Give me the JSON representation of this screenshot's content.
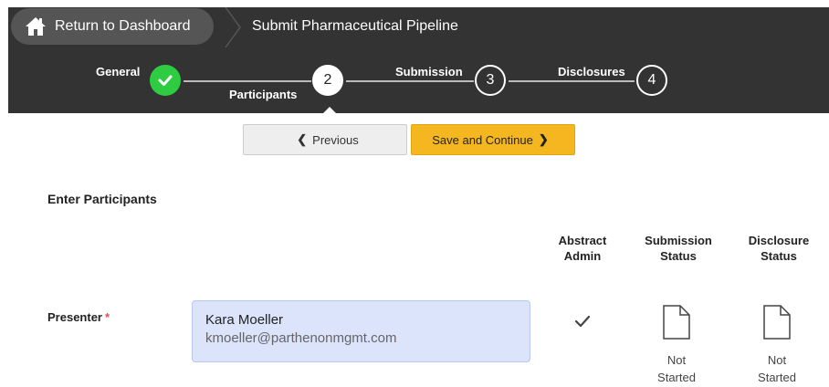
{
  "breadcrumb": {
    "return_label": "Return to Dashboard",
    "title": "Submit Pharmaceutical Pipeline"
  },
  "steps": [
    {
      "label": "General",
      "number": "",
      "state": "complete"
    },
    {
      "label": "Participants",
      "number": "2",
      "state": "active"
    },
    {
      "label": "Submission",
      "number": "3",
      "state": "pending"
    },
    {
      "label": "Disclosures",
      "number": "4",
      "state": "pending"
    }
  ],
  "actions": {
    "previous_label": "Previous",
    "next_label": "Save and Continue"
  },
  "section": {
    "title": "Enter Participants"
  },
  "columns": {
    "abstract_admin": [
      "Abstract",
      "Admin"
    ],
    "submission_status": [
      "Submission",
      "Status"
    ],
    "disclosure_status": [
      "Disclosure",
      "Status"
    ]
  },
  "presenter": {
    "label": "Presenter",
    "required_mark": "*",
    "name": "Kara Moeller",
    "email": "kmoeller@parthenonmgmt.com",
    "abstract_admin": true,
    "submission_status": [
      "Not",
      "Started"
    ],
    "disclosure_status": [
      "Not",
      "Started"
    ]
  },
  "colors": {
    "header_bg": "#333333",
    "complete": "#2ecc40",
    "primary_button": "#f5b71f",
    "participant_bg": "#dbe4fb"
  }
}
